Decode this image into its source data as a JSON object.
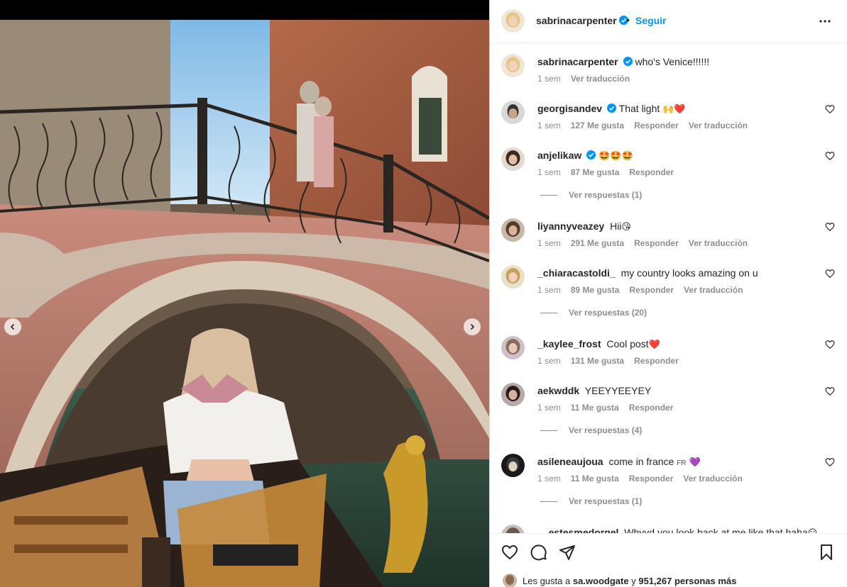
{
  "post": {
    "author": "sabrinacarpenter",
    "follow_label": "Seguir",
    "dot": "•",
    "caption_text": "who's Venice!!!!!!",
    "caption_time": "1 sem",
    "caption_translate": "Ver traducción"
  },
  "comments": [
    {
      "user": "georgisandev",
      "verified": true,
      "text": "That light",
      "emoji": "🙌❤️",
      "time": "1 sem",
      "likes": "127 Me gusta",
      "reply": "Responder",
      "translate": "Ver traducción",
      "replies": ""
    },
    {
      "user": "anjelikaw",
      "verified": true,
      "text": "",
      "emoji": "🤩🤩🤩",
      "time": "1 sem",
      "likes": "87 Me gusta",
      "reply": "Responder",
      "translate": "",
      "replies": "Ver respuestas (1)"
    },
    {
      "user": "liyannyveazey",
      "verified": false,
      "text": "Hii",
      "emoji": "😘",
      "time": "1 sem",
      "likes": "291 Me gusta",
      "reply": "Responder",
      "translate": "Ver traducción",
      "replies": ""
    },
    {
      "user": "_chiaracastoldi_",
      "verified": false,
      "text": "my country looks amazing on u",
      "emoji": "",
      "time": "1 sem",
      "likes": "89 Me gusta",
      "reply": "Responder",
      "translate": "Ver traducción",
      "replies": "Ver respuestas (20)"
    },
    {
      "user": "_kaylee_frost",
      "verified": false,
      "text": "Cool post",
      "emoji": "❤️",
      "time": "1 sem",
      "likes": "131 Me gusta",
      "reply": "Responder",
      "translate": "",
      "replies": ""
    },
    {
      "user": "aekwddk",
      "verified": false,
      "text": "YEEYYEEYEY",
      "emoji": "",
      "time": "1 sem",
      "likes": "11 Me gusta",
      "reply": "Responder",
      "translate": "",
      "replies": "Ver respuestas (4)"
    },
    {
      "user": "asileneaujoua",
      "verified": false,
      "text": "come in france",
      "flag": "FR",
      "emoji": "💜",
      "time": "1 sem",
      "likes": "11 Me gusta",
      "reply": "Responder",
      "translate": "Ver traducción",
      "replies": "Ver respuestas (1)"
    },
    {
      "user": "__estesmedorgel",
      "verified": false,
      "text": "Whyyd you look back at me like that haha",
      "emoji": "😏",
      "time": "",
      "likes": "",
      "reply": "",
      "translate": "",
      "replies": ""
    }
  ],
  "likes_line": {
    "prefix": "Les gusta a",
    "user": "sa.woodgate",
    "joiner": "y",
    "count": "951,267 personas más"
  },
  "colors": {
    "accent": "#0095f6",
    "verified": "#0095f6",
    "muted": "#8e8e8e"
  },
  "icons": [
    "verified-badge-icon",
    "more-options-icon",
    "heart-icon",
    "comment-icon",
    "share-icon",
    "bookmark-icon",
    "chevron-left-icon",
    "chevron-right-icon"
  ]
}
